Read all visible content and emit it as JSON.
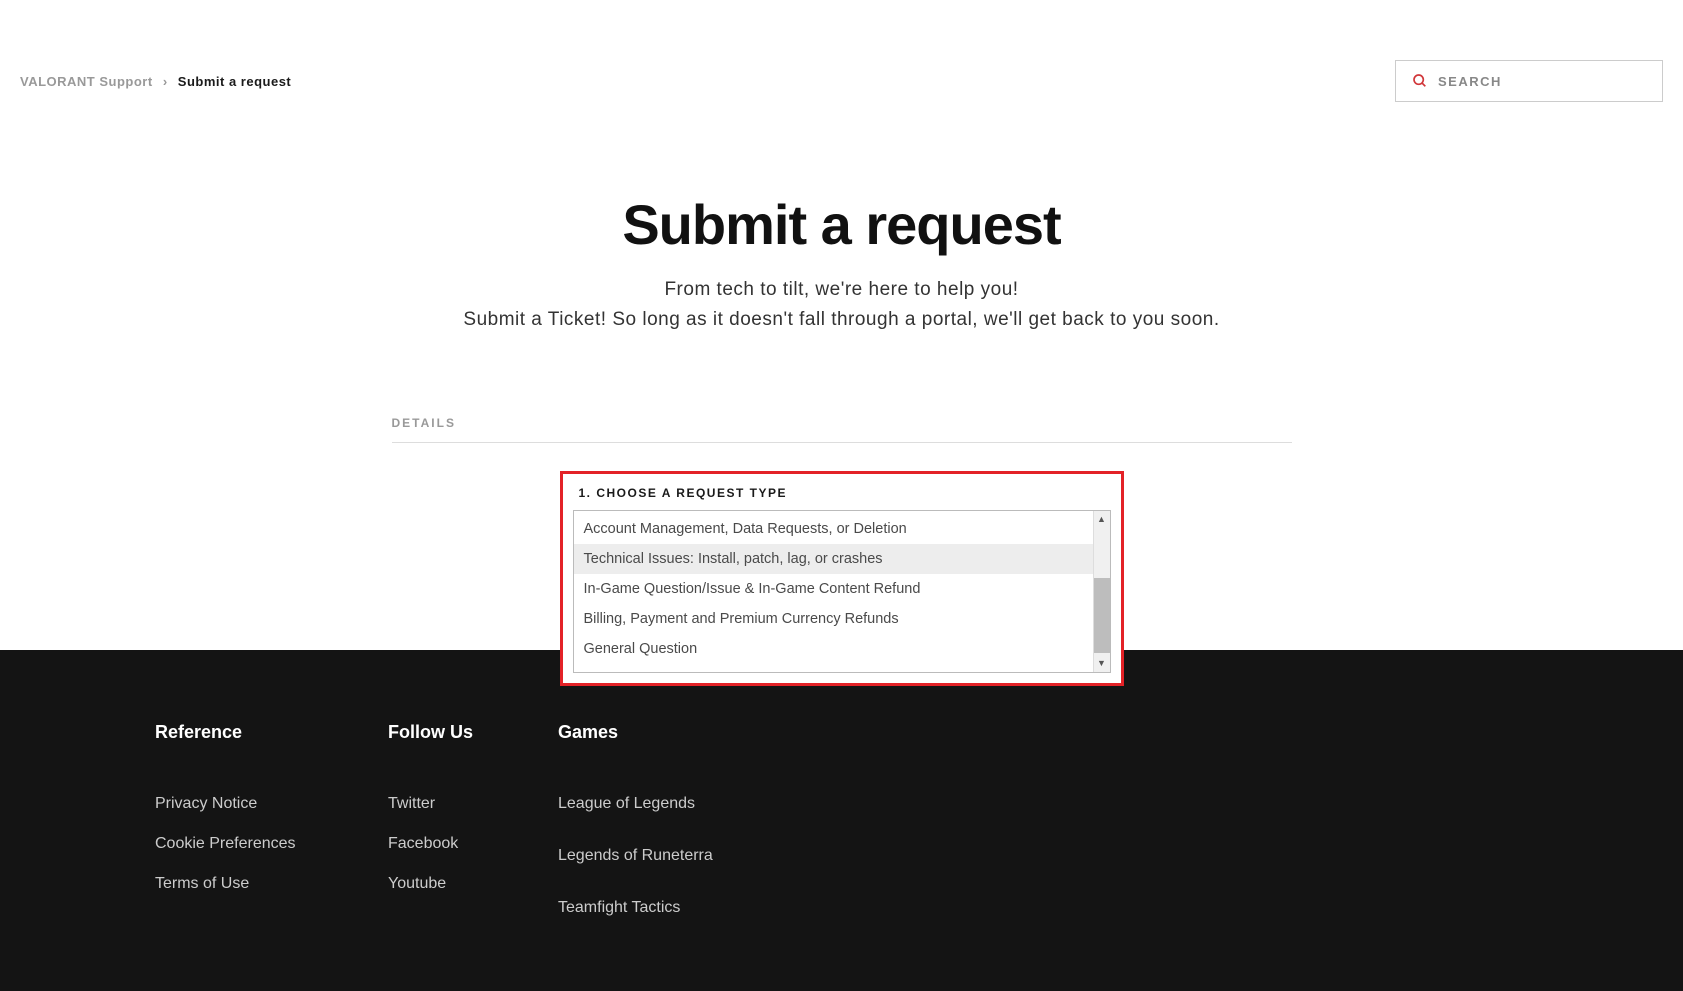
{
  "breadcrumb": {
    "parent": "VALORANT Support",
    "current": "Submit a request"
  },
  "search": {
    "placeholder": "SEARCH"
  },
  "hero": {
    "title": "Submit a request",
    "subtitle_line1": "From tech to tilt, we're here to help you!",
    "subtitle_line2": "Submit a Ticket! So long as it doesn't fall through a portal, we'll get back to you soon."
  },
  "form": {
    "details_label": "DETAILS",
    "request_type_label": "1. CHOOSE A REQUEST TYPE",
    "options": [
      "Account Management, Data Requests, or Deletion",
      "Technical Issues: Install, patch, lag, or crashes",
      "In-Game Question/Issue & In-Game Content Refund",
      "Billing, Payment and Premium Currency Refunds",
      "General Question"
    ]
  },
  "footer": {
    "reference": {
      "title": "Reference",
      "links": [
        "Privacy Notice",
        "Cookie Preferences",
        "Terms of Use"
      ]
    },
    "follow": {
      "title": "Follow Us",
      "links": [
        "Twitter",
        "Facebook",
        "Youtube"
      ]
    },
    "games": {
      "title": "Games",
      "links": [
        "League of Legends",
        "Legends of Runeterra",
        "Teamfight Tactics"
      ]
    }
  }
}
